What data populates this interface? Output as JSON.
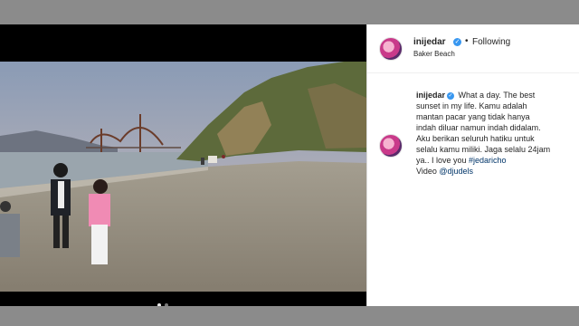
{
  "post": {
    "username": "inijedar",
    "follow_label": "Following",
    "separator": "•",
    "location": "Baker Beach",
    "caption": {
      "username": "inijedar",
      "lines": [
        "What a day. The best",
        "sunset in my life. Kamu adalah",
        "mantan pacar yang tidak hanya",
        "indah diluar namun indah didalam.",
        "Aku berikan seluruh hatiku untuk",
        "selalu kamu miliki. Jaga selalu 24jam",
        "ya.. I love you "
      ],
      "hashtag": "#jedaricho",
      "video_prefix": "Video ",
      "mention": "@djudels"
    }
  },
  "media": {
    "description_icon": "beach-photo",
    "carousel_dots": 2,
    "active_dot": 1
  },
  "colors": {
    "verified": "#3897f0",
    "link": "#003569",
    "text": "#262626",
    "backdrop": "#8b8b8b"
  }
}
